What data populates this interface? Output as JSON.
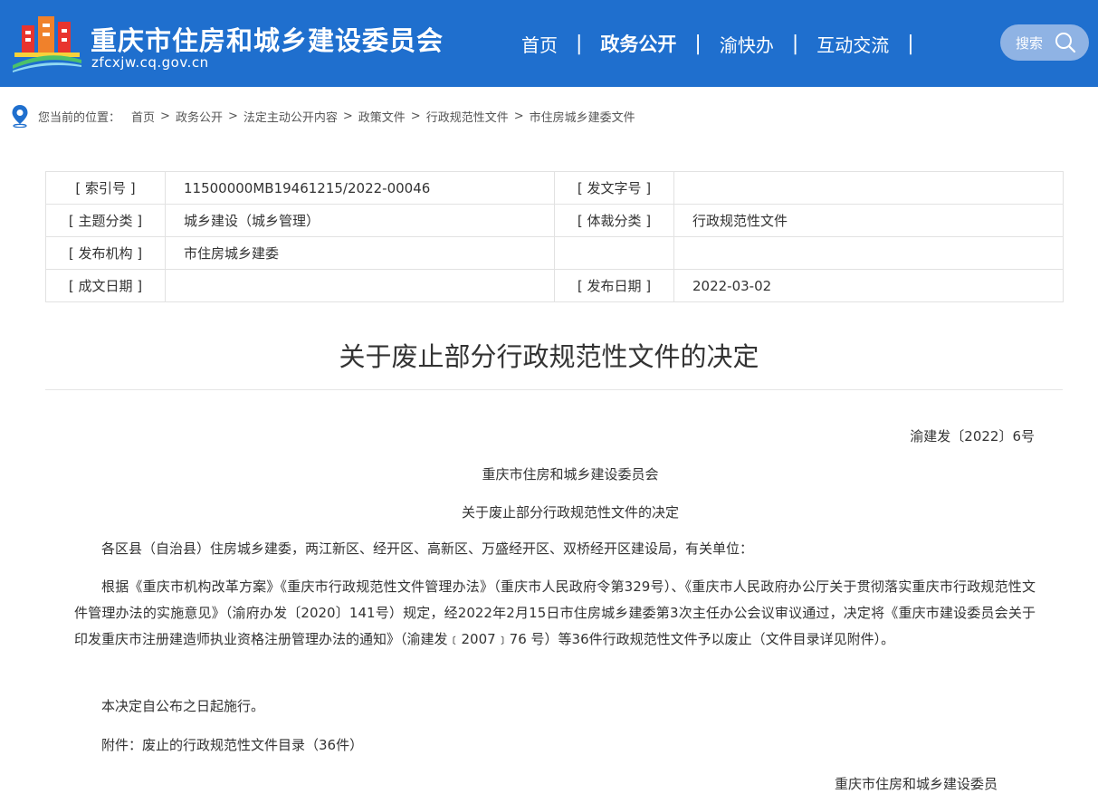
{
  "header": {
    "site_title": "重庆市住房和城乡建设委员会",
    "site_domain": "zfcxjw.cq.gov.cn",
    "nav": [
      "首页",
      "政务公开",
      "渝快办",
      "互动交流"
    ],
    "search_label": "搜索"
  },
  "breadcrumb": {
    "prefix": "您当前的位置：",
    "items": [
      "首页",
      "政务公开",
      "法定主动公开内容",
      "政策文件",
      "行政规范性文件",
      "市住房城乡建委文件"
    ]
  },
  "meta": {
    "index_label": "[ 索引号 ]",
    "index_value": "11500000MB19461215/2022-00046",
    "docnum_label": "[ 发文字号 ]",
    "docnum_value": "",
    "topic_label": "[ 主题分类 ]",
    "topic_value": "城乡建设（城乡管理）",
    "genre_label": "[ 体裁分类 ]",
    "genre_value": "行政规范性文件",
    "issuer_label": "[ 发布机构 ]",
    "issuer_value": "市住房城乡建委",
    "created_label": "[ 成文日期 ]",
    "created_value": "",
    "published_label": "[ 发布日期 ]",
    "published_value": "2022-03-02"
  },
  "doc": {
    "title": "关于废止部分行政规范性文件的决定",
    "number": "渝建发〔2022〕6号",
    "org": "重庆市住房和城乡建设委员会",
    "subtitle": "关于废止部分行政规范性文件的决定",
    "greeting": "各区县（自治县）住房城乡建委，两江新区、经开区、高新区、万盛经开区、双桥经开区建设局，有关单位：",
    "body": "根据《重庆市机构改革方案》《重庆市行政规范性文件管理办法》（重庆市人民政府令第329号）、《重庆市人民政府办公厅关于贯彻落实重庆市行政规范性文件管理办法的实施意见》（渝府办发〔2020〕141号）规定，经2022年2月15日市住房城乡建委第3次主任办公会议审议通过，决定将《重庆市建设委员会关于印发重庆市注册建造师执业资格注册管理办法的通知》（渝建发﹝2007﹞76 号）等36件行政规范性文件予以废止（文件目录详见附件）。",
    "effective": "本决定自公布之日起施行。",
    "attachment": "附件：废止的行政规范性文件目录（36件）",
    "signature": "重庆市住房和城乡建设委员"
  },
  "colors": {
    "header_bg": "#1f6fce",
    "search_bg": "#8fb3e4"
  }
}
